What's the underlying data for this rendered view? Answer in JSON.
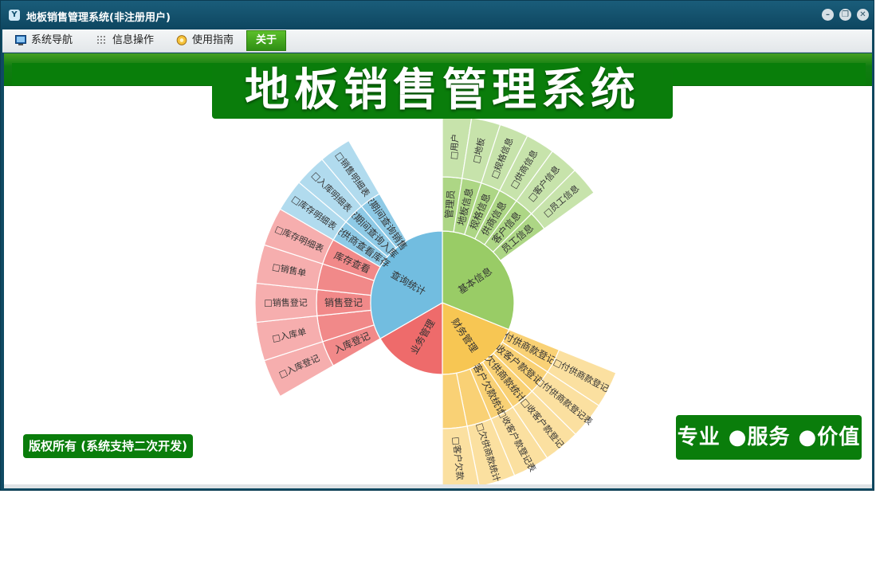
{
  "window": {
    "title": "地板销售管理系统(非注册用户)",
    "app_icon": "Y"
  },
  "menu": [
    {
      "label": "系统导航",
      "icon": "monitor-icon"
    },
    {
      "label": "信息操作",
      "icon": "grid-icon"
    },
    {
      "label": "使用指南",
      "icon": "help-icon"
    },
    {
      "label": "关于",
      "icon": "",
      "active": true
    }
  ],
  "banner": {
    "title": "地板销售管理系统"
  },
  "footer": {
    "copyright": "版权所有 (系统支持二次开发)",
    "slogan": "专业 ●服务 ●价值"
  },
  "colors": {
    "basic": "#99cc66",
    "finance": "#f7c653",
    "business": "#ee6b6b",
    "query": "#72bde0",
    "accent": "#0a7d0b"
  },
  "sunburst": {
    "groups": [
      {
        "name": "基本信息",
        "color_key": "basic",
        "children": [
          {
            "label": "管理员",
            "outer": "□用户"
          },
          {
            "label": "地板信息",
            "outer": "□地板"
          },
          {
            "label": "规格信息",
            "outer": "□规格信息"
          },
          {
            "label": "供商信息",
            "outer": "□供商信息"
          },
          {
            "label": "客户信息",
            "outer": "□客户信息"
          },
          {
            "label": "员工信息",
            "outer": "□员工信息"
          }
        ]
      },
      {
        "name": "财务管理",
        "color_key": "finance",
        "children": [
          {
            "label": "付供商款登记",
            "outer": "□付供商款登记"
          },
          {
            "label": "收客户款登记",
            "outer": "□付供商款登记表"
          },
          {
            "label": "欠供商款统计",
            "outer": "□收客户款登记"
          },
          {
            "label": "客户欠款统计",
            "outer": "□收客户款登记表"
          },
          {
            "label": "",
            "outer": "□欠供商款统计"
          },
          {
            "label": "",
            "outer": "□客户欠款"
          }
        ]
      },
      {
        "name": "业务管理",
        "color_key": "business",
        "children": [
          {
            "label": "入库登记",
            "outer": "□入库登记"
          },
          {
            "label": "",
            "outer": "□入库单"
          },
          {
            "label": "销售登记",
            "outer": "□销售登记"
          },
          {
            "label": "",
            "outer": "□销售单"
          },
          {
            "label": "库存查看",
            "outer": "□库存明细表"
          }
        ]
      },
      {
        "name": "查询统计",
        "color_key": "query",
        "children": [
          {
            "label": "按供商查看库存",
            "outer": "□库存明细表"
          },
          {
            "label": "按期间查询入库",
            "outer": "□入库明细表"
          },
          {
            "label": "按期间查询销售",
            "outer": "□销售明细表"
          }
        ]
      }
    ]
  }
}
